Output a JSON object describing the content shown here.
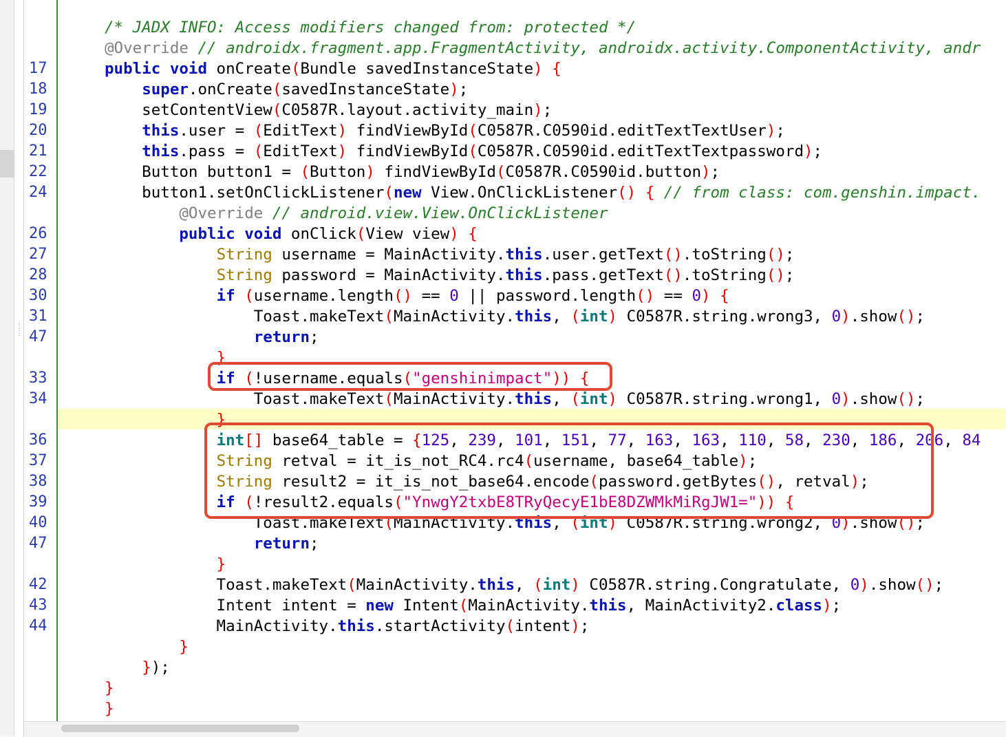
{
  "gutter": {
    "line_numbers": [
      "",
      "",
      "17",
      "18",
      "19",
      "20",
      "21",
      "22",
      "24",
      "",
      "26",
      "27",
      "28",
      "30",
      "31",
      "47",
      "",
      "33",
      "34",
      "",
      "36",
      "37",
      "38",
      "39",
      "40",
      "47",
      "",
      "42",
      "43",
      "44",
      "",
      "",
      "",
      ""
    ]
  },
  "code": {
    "lines": [
      [
        {
          "c": "comment",
          "t": "/* JADX INFO: Access modifiers changed from: protected */"
        }
      ],
      [
        {
          "c": "annot",
          "t": "@Override"
        },
        {
          "c": "",
          "t": " "
        },
        {
          "c": "comment",
          "t": "// androidx.fragment.app.FragmentActivity, androidx.activity.ComponentActivity, andr"
        }
      ],
      [
        {
          "c": "kw",
          "t": "public"
        },
        {
          "c": "",
          "t": " "
        },
        {
          "c": "kw",
          "t": "void"
        },
        {
          "c": "",
          "t": " onCreate"
        },
        {
          "c": "br",
          "t": "("
        },
        {
          "c": "",
          "t": "Bundle savedInstanceState"
        },
        {
          "c": "br",
          "t": ")"
        },
        {
          "c": "",
          "t": " "
        },
        {
          "c": "br",
          "t": "{"
        }
      ],
      [
        {
          "c": "",
          "t": "    "
        },
        {
          "c": "kw",
          "t": "super"
        },
        {
          "c": "",
          "t": ".onCreate"
        },
        {
          "c": "br",
          "t": "("
        },
        {
          "c": "",
          "t": "savedInstanceState"
        },
        {
          "c": "br",
          "t": ")"
        },
        {
          "c": "",
          "t": ";"
        }
      ],
      [
        {
          "c": "",
          "t": "    setContentView"
        },
        {
          "c": "br",
          "t": "("
        },
        {
          "c": "",
          "t": "C0587R.layout.activity_main"
        },
        {
          "c": "br",
          "t": ")"
        },
        {
          "c": "",
          "t": ";"
        }
      ],
      [
        {
          "c": "",
          "t": "    "
        },
        {
          "c": "kw",
          "t": "this"
        },
        {
          "c": "",
          "t": ".user = "
        },
        {
          "c": "br",
          "t": "("
        },
        {
          "c": "",
          "t": "EditText"
        },
        {
          "c": "br",
          "t": ")"
        },
        {
          "c": "",
          "t": " findViewById"
        },
        {
          "c": "br",
          "t": "("
        },
        {
          "c": "",
          "t": "C0587R.C0590id.editTextTextUser"
        },
        {
          "c": "br",
          "t": ")"
        },
        {
          "c": "",
          "t": ";"
        }
      ],
      [
        {
          "c": "",
          "t": "    "
        },
        {
          "c": "kw",
          "t": "this"
        },
        {
          "c": "",
          "t": ".pass = "
        },
        {
          "c": "br",
          "t": "("
        },
        {
          "c": "",
          "t": "EditText"
        },
        {
          "c": "br",
          "t": ")"
        },
        {
          "c": "",
          "t": " findViewById"
        },
        {
          "c": "br",
          "t": "("
        },
        {
          "c": "",
          "t": "C0587R.C0590id.editTextTextpassword"
        },
        {
          "c": "br",
          "t": ")"
        },
        {
          "c": "",
          "t": ";"
        }
      ],
      [
        {
          "c": "",
          "t": "    Button button1 = "
        },
        {
          "c": "br",
          "t": "("
        },
        {
          "c": "",
          "t": "Button"
        },
        {
          "c": "br",
          "t": ")"
        },
        {
          "c": "",
          "t": " findViewById"
        },
        {
          "c": "br",
          "t": "("
        },
        {
          "c": "",
          "t": "C0587R.C0590id.button"
        },
        {
          "c": "br",
          "t": ")"
        },
        {
          "c": "",
          "t": ";"
        }
      ],
      [
        {
          "c": "",
          "t": "    button1.setOnClickListener"
        },
        {
          "c": "br",
          "t": "("
        },
        {
          "c": "kw",
          "t": "new"
        },
        {
          "c": "",
          "t": " View.OnClickListener"
        },
        {
          "c": "br",
          "t": "()"
        },
        {
          "c": "",
          "t": " "
        },
        {
          "c": "br",
          "t": "{"
        },
        {
          "c": "",
          "t": " "
        },
        {
          "c": "comment",
          "t": "// from class: com.genshin.impact."
        }
      ],
      [
        {
          "c": "",
          "t": "        "
        },
        {
          "c": "annot",
          "t": "@Override"
        },
        {
          "c": "",
          "t": " "
        },
        {
          "c": "comment",
          "t": "// android.view.View.OnClickListener"
        }
      ],
      [
        {
          "c": "",
          "t": "        "
        },
        {
          "c": "kw",
          "t": "public"
        },
        {
          "c": "",
          "t": " "
        },
        {
          "c": "kw",
          "t": "void"
        },
        {
          "c": "",
          "t": " onClick"
        },
        {
          "c": "br",
          "t": "("
        },
        {
          "c": "",
          "t": "View view"
        },
        {
          "c": "br",
          "t": ")"
        },
        {
          "c": "",
          "t": " "
        },
        {
          "c": "br",
          "t": "{"
        }
      ],
      [
        {
          "c": "",
          "t": "            "
        },
        {
          "c": "type",
          "t": "String"
        },
        {
          "c": "",
          "t": " username = MainActivity."
        },
        {
          "c": "kw",
          "t": "this"
        },
        {
          "c": "",
          "t": ".user.getText"
        },
        {
          "c": "br",
          "t": "()"
        },
        {
          "c": "",
          "t": ".toString"
        },
        {
          "c": "br",
          "t": "()"
        },
        {
          "c": "",
          "t": ";"
        }
      ],
      [
        {
          "c": "",
          "t": "            "
        },
        {
          "c": "type",
          "t": "String"
        },
        {
          "c": "",
          "t": " password = MainActivity."
        },
        {
          "c": "kw",
          "t": "this"
        },
        {
          "c": "",
          "t": ".pass.getText"
        },
        {
          "c": "br",
          "t": "()"
        },
        {
          "c": "",
          "t": ".toString"
        },
        {
          "c": "br",
          "t": "()"
        },
        {
          "c": "",
          "t": ";"
        }
      ],
      [
        {
          "c": "",
          "t": "            "
        },
        {
          "c": "kw",
          "t": "if"
        },
        {
          "c": "",
          "t": " "
        },
        {
          "c": "br",
          "t": "("
        },
        {
          "c": "",
          "t": "username.length"
        },
        {
          "c": "br",
          "t": "()"
        },
        {
          "c": "",
          "t": " == "
        },
        {
          "c": "num",
          "t": "0"
        },
        {
          "c": "",
          "t": " || password.length"
        },
        {
          "c": "br",
          "t": "()"
        },
        {
          "c": "",
          "t": " == "
        },
        {
          "c": "num",
          "t": "0"
        },
        {
          "c": "br",
          "t": ")"
        },
        {
          "c": "",
          "t": " "
        },
        {
          "c": "br",
          "t": "{"
        }
      ],
      [
        {
          "c": "",
          "t": "                Toast.makeText"
        },
        {
          "c": "br",
          "t": "("
        },
        {
          "c": "",
          "t": "MainActivity."
        },
        {
          "c": "kw",
          "t": "this"
        },
        {
          "c": "",
          "t": ", "
        },
        {
          "c": "br",
          "t": "("
        },
        {
          "c": "prim",
          "t": "int"
        },
        {
          "c": "br",
          "t": ")"
        },
        {
          "c": "",
          "t": " C0587R.string.wrong3, "
        },
        {
          "c": "num",
          "t": "0"
        },
        {
          "c": "br",
          "t": ")"
        },
        {
          "c": "",
          "t": ".show"
        },
        {
          "c": "br",
          "t": "()"
        },
        {
          "c": "",
          "t": ";"
        }
      ],
      [
        {
          "c": "",
          "t": "                "
        },
        {
          "c": "kw",
          "t": "return"
        },
        {
          "c": "",
          "t": ";"
        }
      ],
      [
        {
          "c": "",
          "t": "            "
        },
        {
          "c": "br",
          "t": "}"
        }
      ],
      [
        {
          "c": "",
          "t": "            "
        },
        {
          "c": "kw",
          "t": "if"
        },
        {
          "c": "",
          "t": " "
        },
        {
          "c": "br",
          "t": "("
        },
        {
          "c": "",
          "t": "!username.equals"
        },
        {
          "c": "br",
          "t": "("
        },
        {
          "c": "str",
          "t": "\"genshinimpact\""
        },
        {
          "c": "br",
          "t": "))"
        },
        {
          "c": "",
          "t": " "
        },
        {
          "c": "br",
          "t": "{"
        }
      ],
      [
        {
          "c": "",
          "t": "                Toast.makeText"
        },
        {
          "c": "br",
          "t": "("
        },
        {
          "c": "",
          "t": "MainActivity."
        },
        {
          "c": "kw",
          "t": "this"
        },
        {
          "c": "",
          "t": ", "
        },
        {
          "c": "br",
          "t": "("
        },
        {
          "c": "prim",
          "t": "int"
        },
        {
          "c": "br",
          "t": ")"
        },
        {
          "c": "",
          "t": " C0587R.string.wrong1, "
        },
        {
          "c": "num",
          "t": "0"
        },
        {
          "c": "br",
          "t": ")"
        },
        {
          "c": "",
          "t": ".show"
        },
        {
          "c": "br",
          "t": "()"
        },
        {
          "c": "",
          "t": ";"
        }
      ],
      [
        {
          "c": "",
          "t": "            "
        },
        {
          "c": "br",
          "t": "}"
        }
      ],
      [
        {
          "c": "",
          "t": "            "
        },
        {
          "c": "prim",
          "t": "int"
        },
        {
          "c": "br",
          "t": "[]"
        },
        {
          "c": "",
          "t": " base64_table = "
        },
        {
          "c": "br",
          "t": "{"
        },
        {
          "c": "num",
          "t": "125"
        },
        {
          "c": "",
          "t": ", "
        },
        {
          "c": "num",
          "t": "239"
        },
        {
          "c": "",
          "t": ", "
        },
        {
          "c": "num",
          "t": "101"
        },
        {
          "c": "",
          "t": ", "
        },
        {
          "c": "num",
          "t": "151"
        },
        {
          "c": "",
          "t": ", "
        },
        {
          "c": "num",
          "t": "77"
        },
        {
          "c": "",
          "t": ", "
        },
        {
          "c": "num",
          "t": "163"
        },
        {
          "c": "",
          "t": ", "
        },
        {
          "c": "num",
          "t": "163"
        },
        {
          "c": "",
          "t": ", "
        },
        {
          "c": "num",
          "t": "110"
        },
        {
          "c": "",
          "t": ", "
        },
        {
          "c": "num",
          "t": "58"
        },
        {
          "c": "",
          "t": ", "
        },
        {
          "c": "num",
          "t": "230"
        },
        {
          "c": "",
          "t": ", "
        },
        {
          "c": "num",
          "t": "186"
        },
        {
          "c": "",
          "t": ", "
        },
        {
          "c": "num",
          "t": "206"
        },
        {
          "c": "",
          "t": ", "
        },
        {
          "c": "num",
          "t": "84"
        }
      ],
      [
        {
          "c": "",
          "t": "            "
        },
        {
          "c": "type",
          "t": "String"
        },
        {
          "c": "",
          "t": " retval = it_is_not_RC4.rc4"
        },
        {
          "c": "br",
          "t": "("
        },
        {
          "c": "",
          "t": "username, base64_table"
        },
        {
          "c": "br",
          "t": ")"
        },
        {
          "c": "",
          "t": ";"
        }
      ],
      [
        {
          "c": "",
          "t": "            "
        },
        {
          "c": "type",
          "t": "String"
        },
        {
          "c": "",
          "t": " result2 = it_is_not_base64.encode"
        },
        {
          "c": "br",
          "t": "("
        },
        {
          "c": "",
          "t": "password.getBytes"
        },
        {
          "c": "br",
          "t": "()"
        },
        {
          "c": "",
          "t": ", retval"
        },
        {
          "c": "br",
          "t": ")"
        },
        {
          "c": "",
          "t": ";"
        }
      ],
      [
        {
          "c": "",
          "t": "            "
        },
        {
          "c": "kw",
          "t": "if"
        },
        {
          "c": "",
          "t": " "
        },
        {
          "c": "br",
          "t": "("
        },
        {
          "c": "",
          "t": "!result2.equals"
        },
        {
          "c": "br",
          "t": "("
        },
        {
          "c": "str",
          "t": "\"YnwgY2txbE8TRyQecyE1bE8DZWMkMiRgJW1=\""
        },
        {
          "c": "br",
          "t": "))"
        },
        {
          "c": "",
          "t": " "
        },
        {
          "c": "br",
          "t": "{"
        }
      ],
      [
        {
          "c": "",
          "t": "                Toast.makeText"
        },
        {
          "c": "br",
          "t": "("
        },
        {
          "c": "",
          "t": "MainActivity."
        },
        {
          "c": "kw",
          "t": "this"
        },
        {
          "c": "",
          "t": ", "
        },
        {
          "c": "br",
          "t": "("
        },
        {
          "c": "prim",
          "t": "int"
        },
        {
          "c": "br",
          "t": ")"
        },
        {
          "c": "",
          "t": " C0587R.string.wrong2, "
        },
        {
          "c": "num",
          "t": "0"
        },
        {
          "c": "br",
          "t": ")"
        },
        {
          "c": "",
          "t": ".show"
        },
        {
          "c": "br",
          "t": "()"
        },
        {
          "c": "",
          "t": ";"
        }
      ],
      [
        {
          "c": "",
          "t": "                "
        },
        {
          "c": "kw",
          "t": "return"
        },
        {
          "c": "",
          "t": ";"
        }
      ],
      [
        {
          "c": "",
          "t": "            "
        },
        {
          "c": "br",
          "t": "}"
        }
      ],
      [
        {
          "c": "",
          "t": "            Toast.makeText"
        },
        {
          "c": "br",
          "t": "("
        },
        {
          "c": "",
          "t": "MainActivity."
        },
        {
          "c": "kw",
          "t": "this"
        },
        {
          "c": "",
          "t": ", "
        },
        {
          "c": "br",
          "t": "("
        },
        {
          "c": "prim",
          "t": "int"
        },
        {
          "c": "br",
          "t": ")"
        },
        {
          "c": "",
          "t": " C0587R.string.Congratulate, "
        },
        {
          "c": "num",
          "t": "0"
        },
        {
          "c": "br",
          "t": ")"
        },
        {
          "c": "",
          "t": ".show"
        },
        {
          "c": "br",
          "t": "()"
        },
        {
          "c": "",
          "t": ";"
        }
      ],
      [
        {
          "c": "",
          "t": "            Intent intent = "
        },
        {
          "c": "kw",
          "t": "new"
        },
        {
          "c": "",
          "t": " Intent"
        },
        {
          "c": "br",
          "t": "("
        },
        {
          "c": "",
          "t": "MainActivity."
        },
        {
          "c": "kw",
          "t": "this"
        },
        {
          "c": "",
          "t": ", MainActivity2."
        },
        {
          "c": "kw",
          "t": "class"
        },
        {
          "c": "br",
          "t": ")"
        },
        {
          "c": "",
          "t": ";"
        }
      ],
      [
        {
          "c": "",
          "t": "            MainActivity."
        },
        {
          "c": "kw",
          "t": "this"
        },
        {
          "c": "",
          "t": ".startActivity"
        },
        {
          "c": "br",
          "t": "("
        },
        {
          "c": "",
          "t": "intent"
        },
        {
          "c": "br",
          "t": ")"
        },
        {
          "c": "",
          "t": ";"
        }
      ],
      [
        {
          "c": "",
          "t": "        "
        },
        {
          "c": "br",
          "t": "}"
        }
      ],
      [
        {
          "c": "",
          "t": "    "
        },
        {
          "c": "br",
          "t": "}"
        },
        {
          "c": "",
          "t": ");"
        }
      ],
      [
        {
          "c": "br",
          "t": "}"
        }
      ],
      [
        {
          "c": "br",
          "t": "}"
        }
      ]
    ]
  },
  "colors": {
    "keyword": "#0a14b0",
    "comment": "#2a7d2a",
    "string": "#c2007a",
    "number": "#4a00b4",
    "bracket": "#e00000",
    "highlight_row": "#fdfdc6",
    "annotation_box": "#e04a32"
  }
}
